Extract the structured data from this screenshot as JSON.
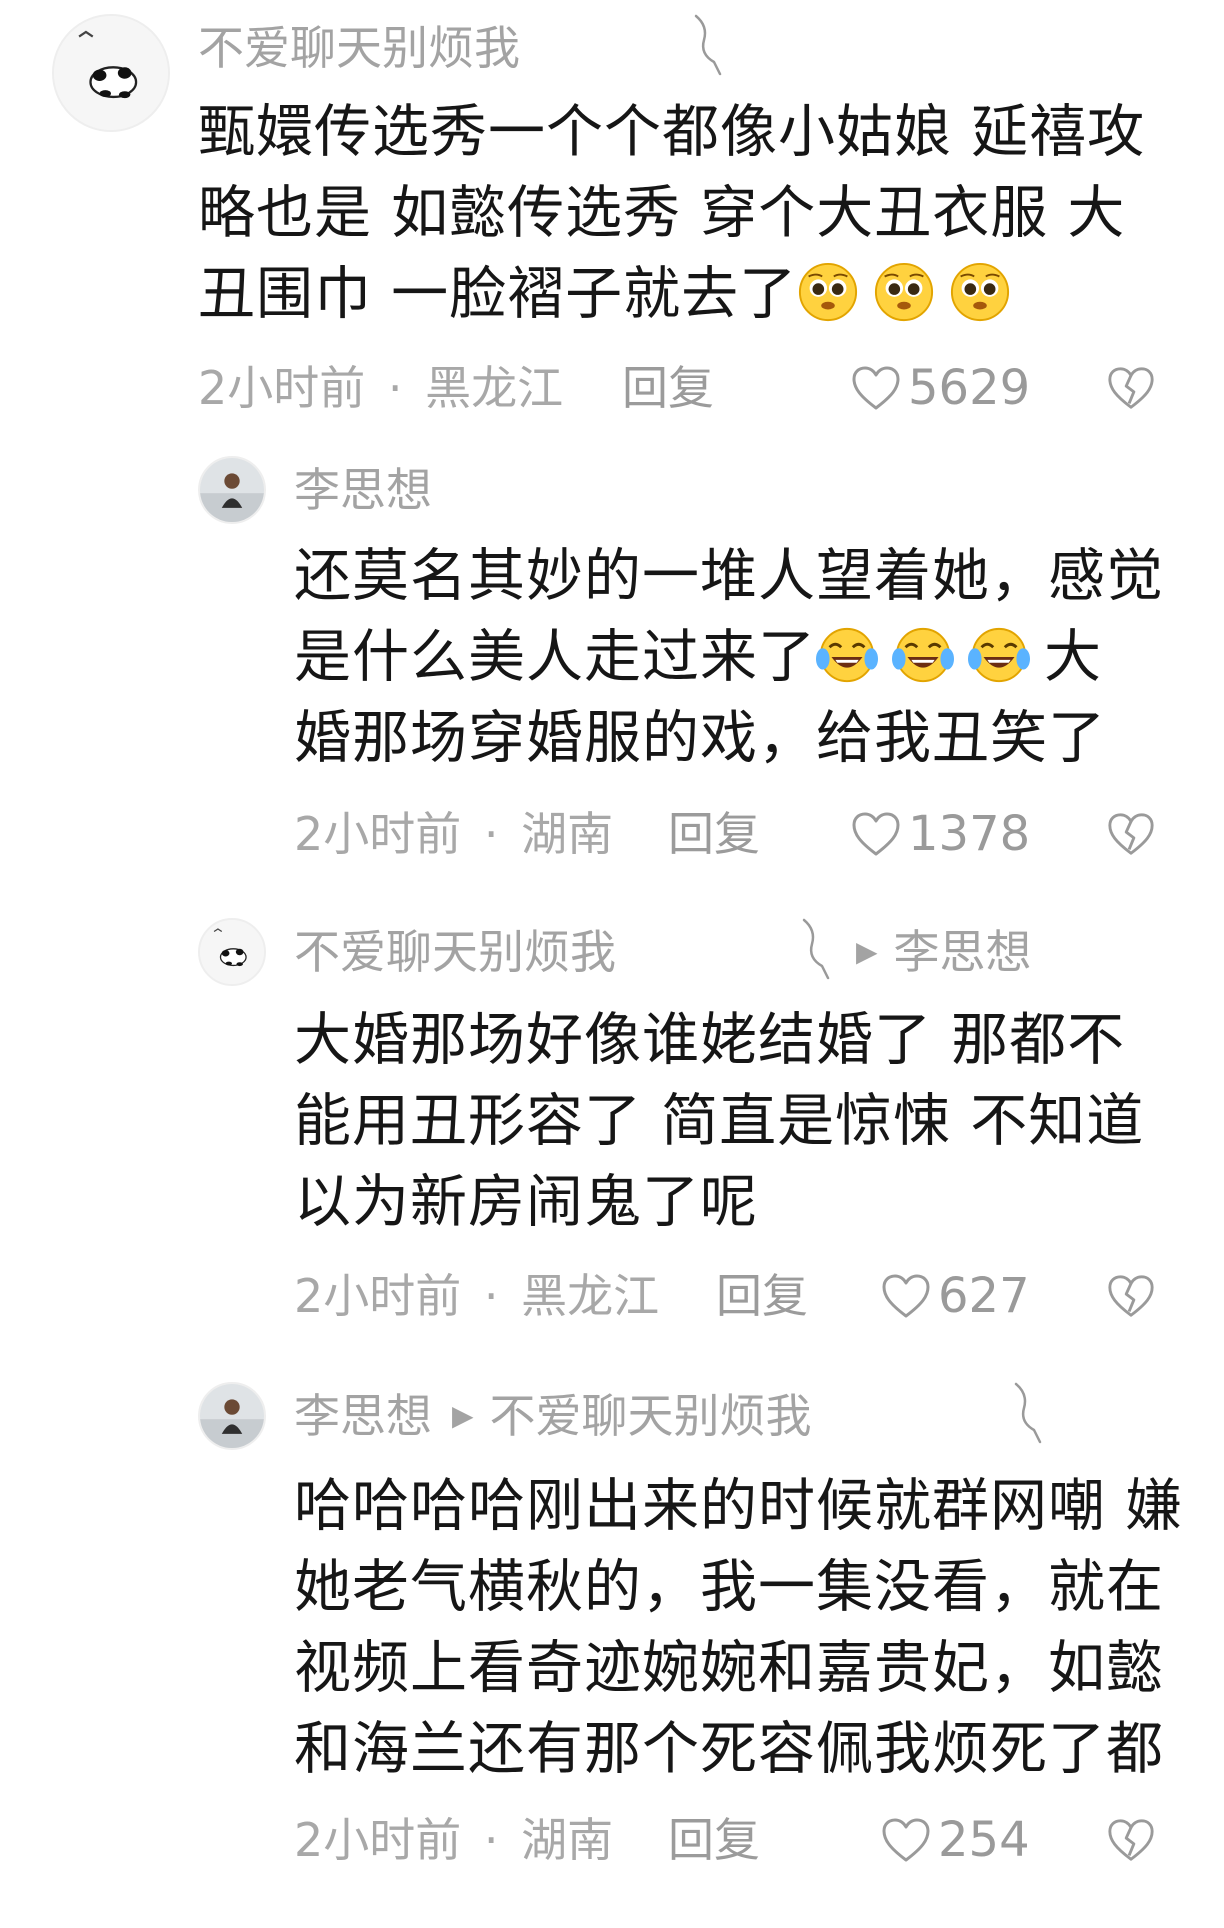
{
  "comments": [
    {
      "user": "不爱聊天别烦我",
      "lines": [
        "甄嬛传选秀一个个都像小姑娘 延禧攻",
        "略也是 如懿传选秀 穿个大丑衣服 大",
        "丑围巾 一脸褶子就去了"
      ],
      "time": "2小时前",
      "location": "黑龙江",
      "reply_label": "回复",
      "likes": "5629"
    },
    {
      "user": "李思想",
      "lines": [
        "还莫名其妙的一堆人望着她，感觉",
        "是什么美人走过来了",
        "婚那场穿婚服的戏，给我丑笑了"
      ],
      "line2_tail": "大",
      "time": "2小时前",
      "location": "湖南",
      "reply_label": "回复",
      "likes": "1378"
    },
    {
      "user": "不爱聊天别烦我",
      "reply_to": "李思想",
      "lines": [
        "大婚那场好像谁姥结婚了 那都不",
        "能用丑形容了 简直是惊悚 不知道",
        "以为新房闹鬼了呢"
      ],
      "time": "2小时前",
      "location": "黑龙江",
      "reply_label": "回复",
      "likes": "627"
    },
    {
      "user": "李思想",
      "reply_to": "不爱聊天别烦我",
      "lines": [
        "哈哈哈哈刚出来的时候就群网嘲 嫌",
        "她老气横秋的，我一集没看，就在",
        "视频上看奇迹婉婉和嘉贵妃，如懿",
        "和海兰还有那个死容佩我烦死了都"
      ],
      "time": "2小时前",
      "location": "湖南",
      "reply_label": "回复",
      "likes": "254"
    }
  ],
  "separator": "·",
  "icons": {
    "like": "heart-outline-icon",
    "dislike": "broken-heart-icon",
    "author_mark": "author-squiggle-icon",
    "reply_arrow": "play-triangle-icon",
    "emoji_1": "pleading-face-emoji",
    "emoji_2": "tears-of-joy-emoji"
  },
  "colors": {
    "text": "#161616",
    "meta": "#a8a8a8",
    "background": "#ffffff"
  }
}
